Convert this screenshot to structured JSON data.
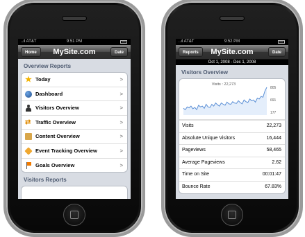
{
  "left": {
    "status": {
      "carrier": "..ıl AT&T",
      "time": "9:51 PM"
    },
    "nav": {
      "left_button": "Home",
      "title": "MySite.com",
      "right_button": "Date"
    },
    "sections": [
      {
        "title": "Overview Reports"
      },
      {
        "title": "Visitors Reports"
      }
    ],
    "items": [
      {
        "label": "Today",
        "icon": "star-icon"
      },
      {
        "label": "Dashboard",
        "icon": "globe-icon"
      },
      {
        "label": "Visitors Overview",
        "icon": "person-icon"
      },
      {
        "label": "Traffic Overview",
        "icon": "arrows-icon"
      },
      {
        "label": "Content Overview",
        "icon": "document-icon"
      },
      {
        "label": "Event Tracking Overview",
        "icon": "tag-icon"
      },
      {
        "label": "Goals Overview",
        "icon": "flag-icon"
      }
    ]
  },
  "right": {
    "status": {
      "carrier": "..ıl AT&T",
      "time": "9:52 PM"
    },
    "nav": {
      "left_button": "Reports",
      "title": "MySite.com",
      "right_button": "Date"
    },
    "date_range": "Oct 1, 2008 - Dec 1, 2008",
    "section": "Visitors Overview",
    "sparkline": {
      "caption": "Visits : 22,273",
      "labels": {
        "max": "805",
        "mid": "691",
        "min": "177"
      },
      "values": [
        330,
        300,
        360,
        340,
        380,
        320,
        350,
        300,
        400,
        360,
        380,
        330,
        420,
        360,
        350,
        420,
        380,
        450,
        410,
        380,
        450,
        420,
        400,
        470,
        430,
        420,
        480,
        450,
        440,
        500,
        460,
        430,
        520,
        480,
        460,
        540,
        500,
        520,
        470,
        560,
        540,
        600,
        580,
        720,
        805
      ]
    },
    "metrics": [
      {
        "label": "Visits",
        "value": "22,273"
      },
      {
        "label": "Absolute Unique Visitors",
        "value": "16,444"
      },
      {
        "label": "Pageviews",
        "value": "58,465"
      },
      {
        "label": "Average Pageviews",
        "value": "2.62"
      },
      {
        "label": "Time on Site",
        "value": "00:01:47"
      },
      {
        "label": "Bounce Rate",
        "value": "67.83%"
      }
    ],
    "colors": {
      "line": "#5a8fd6",
      "fill": "#e4eefb"
    }
  }
}
